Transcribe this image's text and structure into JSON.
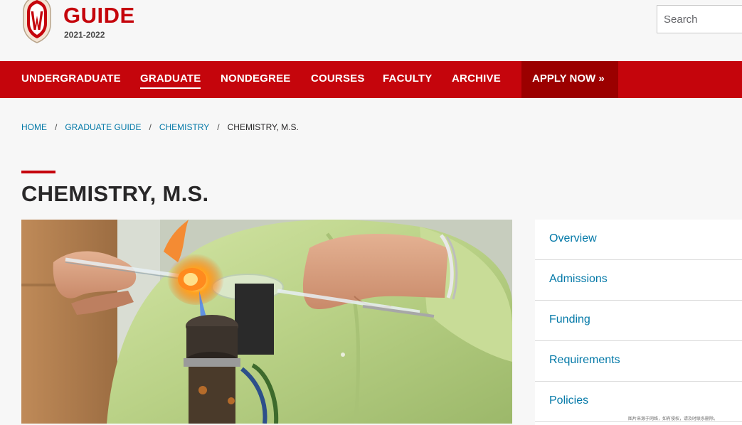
{
  "header": {
    "title": "GUIDE",
    "year": "2021-2022",
    "search_placeholder": "Search"
  },
  "nav": {
    "items": [
      {
        "label": "UNDERGRADUATE",
        "active": false
      },
      {
        "label": "GRADUATE",
        "active": true
      },
      {
        "label": "NONDEGREE",
        "active": false
      },
      {
        "label": "COURSES",
        "active": false
      },
      {
        "label": "FACULTY",
        "active": false
      },
      {
        "label": "ARCHIVE",
        "active": false
      }
    ],
    "apply_label": "APPLY NOW »"
  },
  "breadcrumb": {
    "items": [
      "HOME",
      "GRADUATE GUIDE",
      "CHEMISTRY"
    ],
    "separator": "/",
    "current": "CHEMISTRY, M.S."
  },
  "page": {
    "title": "CHEMISTRY, M.S."
  },
  "sidenav": {
    "items": [
      "Overview",
      "Admissions",
      "Funding",
      "Requirements",
      "Policies"
    ]
  },
  "watermark": "图片来源于网络，如有侵权，请及时联系删除。",
  "colors": {
    "brand_red": "#c5050c",
    "apply_red": "#9b0000",
    "link_blue": "#0479a8",
    "text_dark": "#282728"
  }
}
